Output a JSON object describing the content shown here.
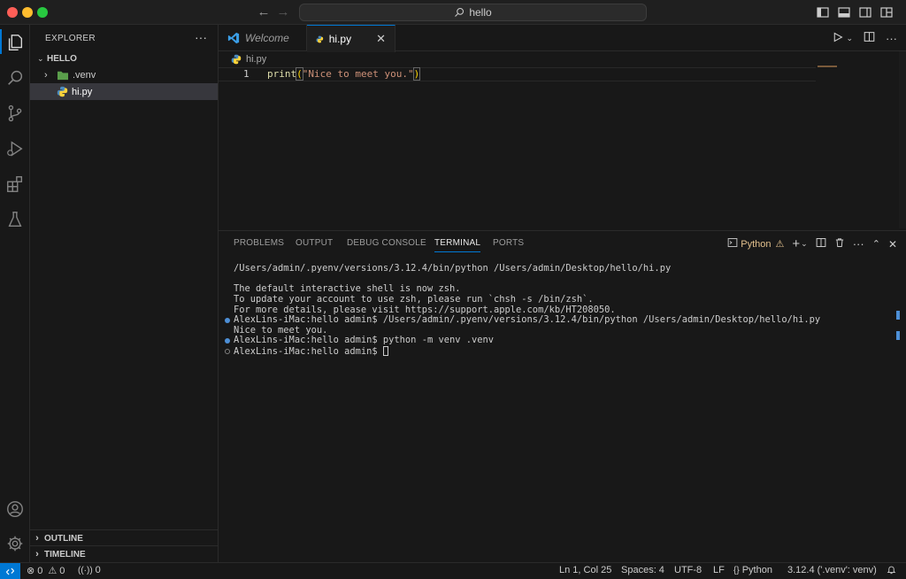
{
  "titlebar": {
    "search_text": "hello"
  },
  "sidebar": {
    "title": "EXPLORER",
    "folder_name": "HELLO",
    "items": [
      {
        "label": ".venv",
        "kind": "folder"
      },
      {
        "label": "hi.py",
        "kind": "python-file",
        "selected": true
      }
    ],
    "outline_label": "OUTLINE",
    "timeline_label": "TIMELINE"
  },
  "tabs": [
    {
      "label": "Welcome",
      "active": false
    },
    {
      "label": "hi.py",
      "active": true
    }
  ],
  "editor": {
    "breadcrumb": "hi.py",
    "lines": [
      {
        "number": "1",
        "fn": "print",
        "open": "(",
        "string": "\"Nice to meet you.\"",
        "close": ")"
      }
    ]
  },
  "panel": {
    "tabs": [
      "PROBLEMS",
      "OUTPUT",
      "DEBUG CONSOLE",
      "TERMINAL",
      "PORTS"
    ],
    "active_tab": "TERMINAL",
    "terminal_name": "Python",
    "terminal_lines": [
      {
        "text": "/Users/admin/.pyenv/versions/3.12.4/bin/python /Users/admin/Desktop/hello/hi.py",
        "marker": "none"
      },
      {
        "text": "",
        "marker": "none"
      },
      {
        "text": "The default interactive shell is now zsh.",
        "marker": "none"
      },
      {
        "text": "To update your account to use zsh, please run `chsh -s /bin/zsh`.",
        "marker": "none"
      },
      {
        "text": "For more details, please visit https://support.apple.com/kb/HT208050.",
        "marker": "none"
      },
      {
        "text": "AlexLins-iMac:hello admin$ /Users/admin/.pyenv/versions/3.12.4/bin/python /Users/admin/Desktop/hello/hi.py",
        "marker": "blue"
      },
      {
        "text": "Nice to meet you.",
        "marker": "none"
      },
      {
        "text": "AlexLins-iMac:hello admin$ python -m venv .venv",
        "marker": "blue"
      },
      {
        "text": "AlexLins-iMac:hello admin$ ",
        "marker": "hollow",
        "cursor": true
      }
    ]
  },
  "statusbar": {
    "errors": "0",
    "warnings": "0",
    "ports": "0",
    "position": "Ln 1, Col 25",
    "spaces": "Spaces: 4",
    "encoding": "UTF-8",
    "eol": "LF",
    "language": "Python",
    "interpreter": "3.12.4 ('.venv': venv)"
  },
  "colors": {
    "accent": "#0078d4",
    "string": "#ce9178",
    "function": "#dcdcaa"
  }
}
